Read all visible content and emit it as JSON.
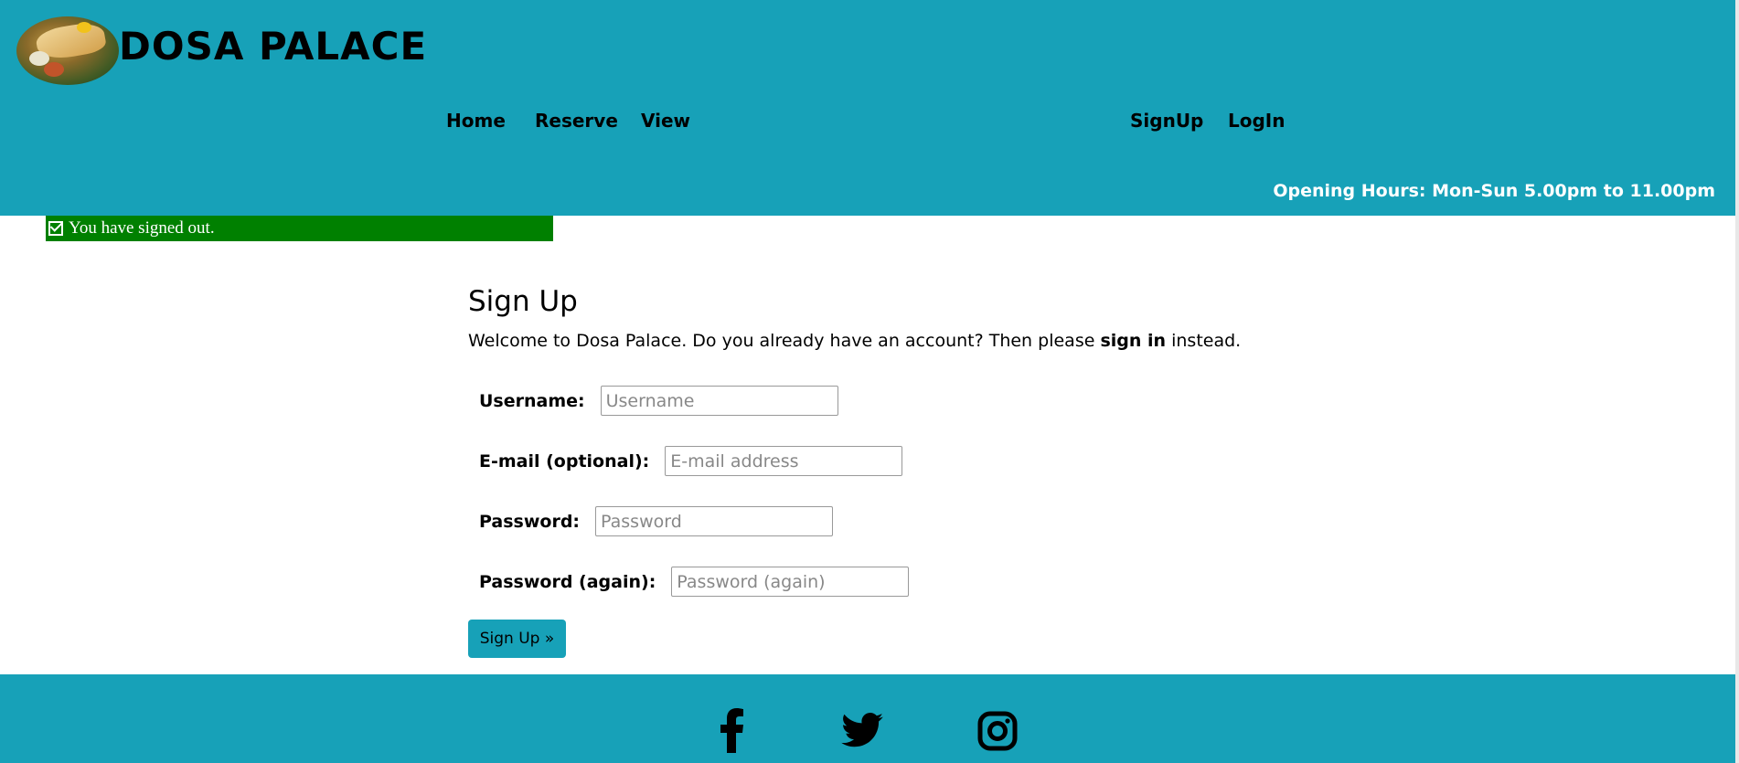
{
  "brand": {
    "name": "DOSA PALACE"
  },
  "nav": {
    "home": "Home",
    "reserve": "Reserve",
    "view": "View",
    "signup": "SignUp",
    "login": "LogIn"
  },
  "header": {
    "hours": "Opening Hours: Mon-Sun 5.00pm to 11.00pm"
  },
  "alert": {
    "message": "You have signed out."
  },
  "form": {
    "title": "Sign Up",
    "intro_before": "Welcome to Dosa Palace. Do you already have an account? Then please ",
    "intro_link": "sign in",
    "intro_after": " instead.",
    "fields": {
      "username": {
        "label": "Username:",
        "placeholder": "Username",
        "value": ""
      },
      "email": {
        "label": "E-mail (optional):",
        "placeholder": "E-mail address",
        "value": ""
      },
      "password": {
        "label": "Password:",
        "placeholder": "Password",
        "value": ""
      },
      "password2": {
        "label": "Password (again):",
        "placeholder": "Password (again)",
        "value": ""
      }
    },
    "submit": "Sign Up »"
  },
  "footer": {
    "icons": [
      "facebook-icon",
      "twitter-icon",
      "instagram-icon"
    ]
  },
  "colors": {
    "accent": "#17a1b8",
    "alert": "#008000"
  }
}
